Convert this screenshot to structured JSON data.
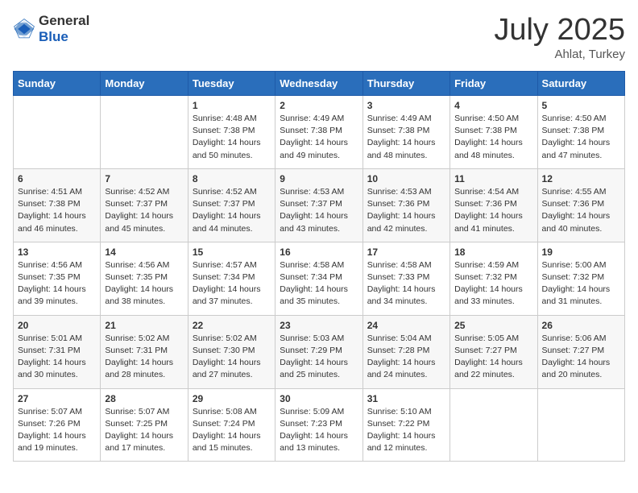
{
  "header": {
    "logo_general": "General",
    "logo_blue": "Blue",
    "month": "July 2025",
    "location": "Ahlat, Turkey"
  },
  "weekdays": [
    "Sunday",
    "Monday",
    "Tuesday",
    "Wednesday",
    "Thursday",
    "Friday",
    "Saturday"
  ],
  "weeks": [
    [
      {
        "day": "",
        "sunrise": "",
        "sunset": "",
        "daylight": ""
      },
      {
        "day": "",
        "sunrise": "",
        "sunset": "",
        "daylight": ""
      },
      {
        "day": "1",
        "sunrise": "Sunrise: 4:48 AM",
        "sunset": "Sunset: 7:38 PM",
        "daylight": "Daylight: 14 hours and 50 minutes."
      },
      {
        "day": "2",
        "sunrise": "Sunrise: 4:49 AM",
        "sunset": "Sunset: 7:38 PM",
        "daylight": "Daylight: 14 hours and 49 minutes."
      },
      {
        "day": "3",
        "sunrise": "Sunrise: 4:49 AM",
        "sunset": "Sunset: 7:38 PM",
        "daylight": "Daylight: 14 hours and 48 minutes."
      },
      {
        "day": "4",
        "sunrise": "Sunrise: 4:50 AM",
        "sunset": "Sunset: 7:38 PM",
        "daylight": "Daylight: 14 hours and 48 minutes."
      },
      {
        "day": "5",
        "sunrise": "Sunrise: 4:50 AM",
        "sunset": "Sunset: 7:38 PM",
        "daylight": "Daylight: 14 hours and 47 minutes."
      }
    ],
    [
      {
        "day": "6",
        "sunrise": "Sunrise: 4:51 AM",
        "sunset": "Sunset: 7:38 PM",
        "daylight": "Daylight: 14 hours and 46 minutes."
      },
      {
        "day": "7",
        "sunrise": "Sunrise: 4:52 AM",
        "sunset": "Sunset: 7:37 PM",
        "daylight": "Daylight: 14 hours and 45 minutes."
      },
      {
        "day": "8",
        "sunrise": "Sunrise: 4:52 AM",
        "sunset": "Sunset: 7:37 PM",
        "daylight": "Daylight: 14 hours and 44 minutes."
      },
      {
        "day": "9",
        "sunrise": "Sunrise: 4:53 AM",
        "sunset": "Sunset: 7:37 PM",
        "daylight": "Daylight: 14 hours and 43 minutes."
      },
      {
        "day": "10",
        "sunrise": "Sunrise: 4:53 AM",
        "sunset": "Sunset: 7:36 PM",
        "daylight": "Daylight: 14 hours and 42 minutes."
      },
      {
        "day": "11",
        "sunrise": "Sunrise: 4:54 AM",
        "sunset": "Sunset: 7:36 PM",
        "daylight": "Daylight: 14 hours and 41 minutes."
      },
      {
        "day": "12",
        "sunrise": "Sunrise: 4:55 AM",
        "sunset": "Sunset: 7:36 PM",
        "daylight": "Daylight: 14 hours and 40 minutes."
      }
    ],
    [
      {
        "day": "13",
        "sunrise": "Sunrise: 4:56 AM",
        "sunset": "Sunset: 7:35 PM",
        "daylight": "Daylight: 14 hours and 39 minutes."
      },
      {
        "day": "14",
        "sunrise": "Sunrise: 4:56 AM",
        "sunset": "Sunset: 7:35 PM",
        "daylight": "Daylight: 14 hours and 38 minutes."
      },
      {
        "day": "15",
        "sunrise": "Sunrise: 4:57 AM",
        "sunset": "Sunset: 7:34 PM",
        "daylight": "Daylight: 14 hours and 37 minutes."
      },
      {
        "day": "16",
        "sunrise": "Sunrise: 4:58 AM",
        "sunset": "Sunset: 7:34 PM",
        "daylight": "Daylight: 14 hours and 35 minutes."
      },
      {
        "day": "17",
        "sunrise": "Sunrise: 4:58 AM",
        "sunset": "Sunset: 7:33 PM",
        "daylight": "Daylight: 14 hours and 34 minutes."
      },
      {
        "day": "18",
        "sunrise": "Sunrise: 4:59 AM",
        "sunset": "Sunset: 7:32 PM",
        "daylight": "Daylight: 14 hours and 33 minutes."
      },
      {
        "day": "19",
        "sunrise": "Sunrise: 5:00 AM",
        "sunset": "Sunset: 7:32 PM",
        "daylight": "Daylight: 14 hours and 31 minutes."
      }
    ],
    [
      {
        "day": "20",
        "sunrise": "Sunrise: 5:01 AM",
        "sunset": "Sunset: 7:31 PM",
        "daylight": "Daylight: 14 hours and 30 minutes."
      },
      {
        "day": "21",
        "sunrise": "Sunrise: 5:02 AM",
        "sunset": "Sunset: 7:31 PM",
        "daylight": "Daylight: 14 hours and 28 minutes."
      },
      {
        "day": "22",
        "sunrise": "Sunrise: 5:02 AM",
        "sunset": "Sunset: 7:30 PM",
        "daylight": "Daylight: 14 hours and 27 minutes."
      },
      {
        "day": "23",
        "sunrise": "Sunrise: 5:03 AM",
        "sunset": "Sunset: 7:29 PM",
        "daylight": "Daylight: 14 hours and 25 minutes."
      },
      {
        "day": "24",
        "sunrise": "Sunrise: 5:04 AM",
        "sunset": "Sunset: 7:28 PM",
        "daylight": "Daylight: 14 hours and 24 minutes."
      },
      {
        "day": "25",
        "sunrise": "Sunrise: 5:05 AM",
        "sunset": "Sunset: 7:27 PM",
        "daylight": "Daylight: 14 hours and 22 minutes."
      },
      {
        "day": "26",
        "sunrise": "Sunrise: 5:06 AM",
        "sunset": "Sunset: 7:27 PM",
        "daylight": "Daylight: 14 hours and 20 minutes."
      }
    ],
    [
      {
        "day": "27",
        "sunrise": "Sunrise: 5:07 AM",
        "sunset": "Sunset: 7:26 PM",
        "daylight": "Daylight: 14 hours and 19 minutes."
      },
      {
        "day": "28",
        "sunrise": "Sunrise: 5:07 AM",
        "sunset": "Sunset: 7:25 PM",
        "daylight": "Daylight: 14 hours and 17 minutes."
      },
      {
        "day": "29",
        "sunrise": "Sunrise: 5:08 AM",
        "sunset": "Sunset: 7:24 PM",
        "daylight": "Daylight: 14 hours and 15 minutes."
      },
      {
        "day": "30",
        "sunrise": "Sunrise: 5:09 AM",
        "sunset": "Sunset: 7:23 PM",
        "daylight": "Daylight: 14 hours and 13 minutes."
      },
      {
        "day": "31",
        "sunrise": "Sunrise: 5:10 AM",
        "sunset": "Sunset: 7:22 PM",
        "daylight": "Daylight: 14 hours and 12 minutes."
      },
      {
        "day": "",
        "sunrise": "",
        "sunset": "",
        "daylight": ""
      },
      {
        "day": "",
        "sunrise": "",
        "sunset": "",
        "daylight": ""
      }
    ]
  ]
}
